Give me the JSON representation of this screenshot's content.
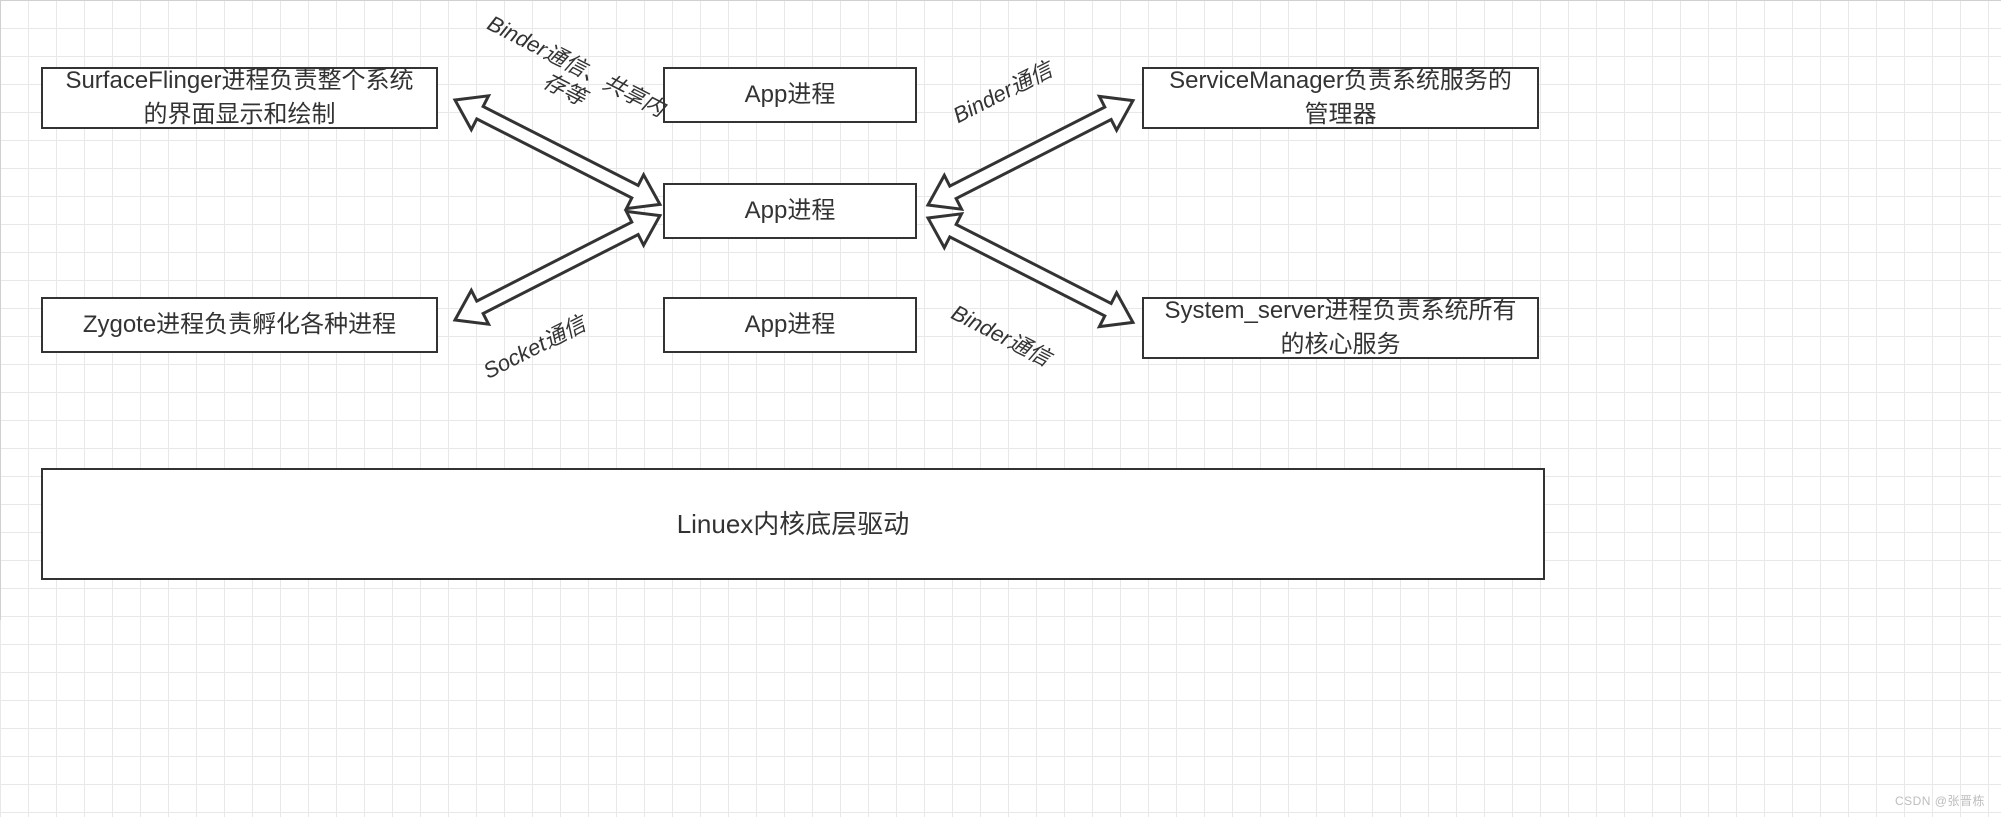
{
  "nodes": {
    "surface_flinger": "SurfaceFlinger进程负责整个系统的界面显示和绘制",
    "zygote": "Zygote进程负责孵化各种进程",
    "app1": "App进程",
    "app2": "App进程",
    "app3": "App进程",
    "service_manager": "ServiceManager负责系统服务的管理器",
    "system_server": "System_server进程负责系统所有的核心服务",
    "kernel": "Linuex内核底层驱动"
  },
  "labels": {
    "binder_shared": "Binder通信、共享内存等",
    "socket": "Socket通信",
    "binder1": "Binder通信",
    "binder2": "Binder通信"
  },
  "watermark": "CSDN @张晋栋"
}
